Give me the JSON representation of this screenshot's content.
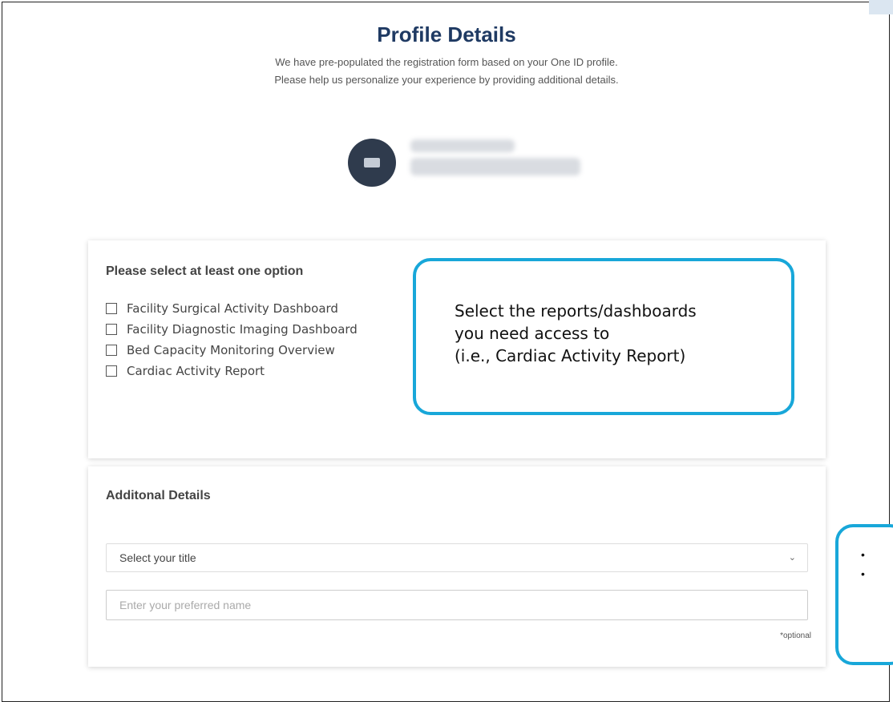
{
  "header": {
    "title": "Profile Details",
    "subtitle_line1": "We have pre-populated the registration form based on your One ID profile.",
    "subtitle_line2": "Please help us personalize your experience by providing additional details."
  },
  "options_card": {
    "heading": "Please select at least one option",
    "options": [
      {
        "label": "Facility Surgical Activity Dashboard",
        "checked": false
      },
      {
        "label": "Facility Diagnostic Imaging Dashboard",
        "checked": false
      },
      {
        "label": "Bed Capacity Monitoring Overview",
        "checked": false
      },
      {
        "label": "Cardiac Activity Report",
        "checked": false
      }
    ]
  },
  "callout": {
    "line1": "Select the reports/dashboards",
    "line2": "you need access to",
    "line3": "(i.e., Cardiac Activity Report)"
  },
  "details_card": {
    "heading": "Additonal Details",
    "title_select": {
      "value": "Select your title"
    },
    "preferred_name": {
      "placeholder": "Enter your preferred name"
    },
    "optional_note": "*optional"
  },
  "side_callout": {
    "bullets": [
      "•",
      "•"
    ]
  },
  "colors": {
    "title": "#1f3a63",
    "callout_border": "#18a7d9",
    "avatar": "#2f3b4d"
  }
}
